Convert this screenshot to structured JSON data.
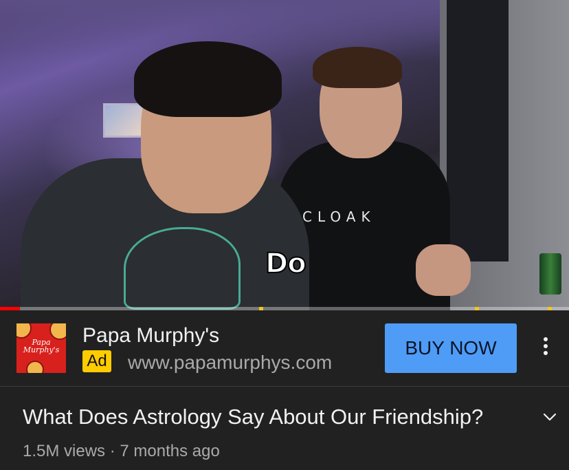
{
  "video": {
    "caption": "Do",
    "shirt_text": "CLOAK",
    "progress": 0.035,
    "ad_markers": [
      0.455,
      0.835,
      0.963
    ]
  },
  "ad": {
    "logo_text": "Papa Murphy's",
    "title": "Papa Murphy's",
    "badge": "Ad",
    "url": "www.papamurphys.com",
    "cta_label": "BUY NOW",
    "more_icon": "more-vert-icon"
  },
  "video_info": {
    "title": "What Does Astrology Say About Our Friendship?",
    "views": "1.5M views",
    "separator": "·",
    "age": "7 months ago",
    "expand_icon": "chevron-down-icon"
  },
  "colors": {
    "background": "#212121",
    "cta": "#4f9cf7",
    "ad_badge": "#ffcc00",
    "progress": "#ff0000",
    "ad_marker": "#f5c518"
  }
}
